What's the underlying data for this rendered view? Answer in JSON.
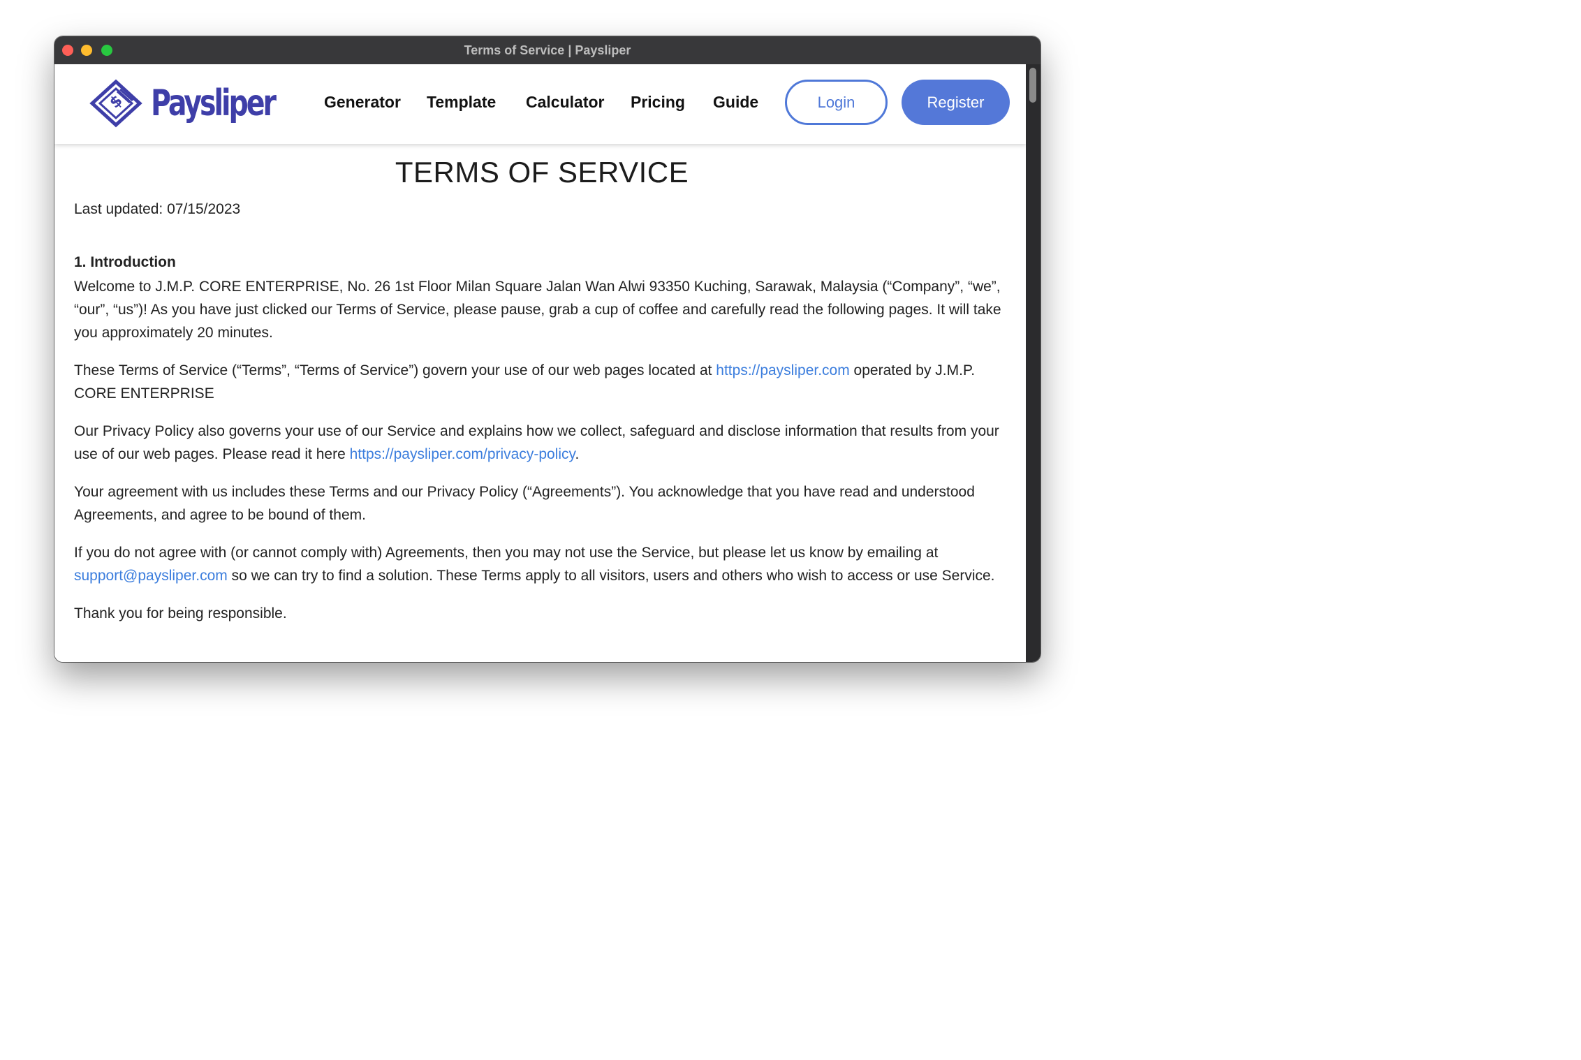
{
  "window": {
    "title": "Terms of Service | Paysliper"
  },
  "brand": {
    "name": "Paysliper",
    "logo_icon": "payslip-diamond-icon",
    "color": "#3e3ea8"
  },
  "nav": {
    "links": [
      "Generator",
      "Template",
      "Calculator",
      "Pricing",
      "Guide"
    ],
    "login_label": "Login",
    "register_label": "Register",
    "accent": "#5478d8"
  },
  "page": {
    "title": "TERMS OF SERVICE",
    "last_updated": "Last updated: 07/15/2023",
    "section_heading": "1. Introduction",
    "p1": "Welcome to J.M.P. CORE ENTERPRISE, No. 26 1st Floor Milan Square Jalan Wan Alwi 93350 Kuching, Sarawak, Malaysia (“Company”, “we”, “our”, “us”)! As you have just clicked our Terms of Service, please pause, grab a cup of coffee and carefully read the following pages. It will take you approximately 20 minutes.",
    "p2_before": "These Terms of Service (“Terms”, “Terms of Service”) govern your use of our web pages located at ",
    "p2_link": "https://paysliper.com",
    "p2_after": " operated by J.M.P. CORE ENTERPRISE",
    "p3_before": "Our Privacy Policy also governs your use of our Service and explains how we collect, safeguard and disclose information that results from your use of our web pages. Please read it here ",
    "p3_link": "https://paysliper.com/privacy-policy",
    "p3_after": ".",
    "p4": "Your agreement with us includes these Terms and our Privacy Policy (“Agreements”). You acknowledge that you have read and understood Agreements, and agree to be bound of them.",
    "p5_before": "If you do not agree with (or cannot comply with) Agreements, then you may not use the Service, but please let us know by emailing at ",
    "p5_link": "support@paysliper.com",
    "p5_after": " so we can try to find a solution. These Terms apply to all visitors, users and others who wish to access or use Service.",
    "p6": "Thank you for being responsible.",
    "link_color": "#3b7ddd"
  }
}
